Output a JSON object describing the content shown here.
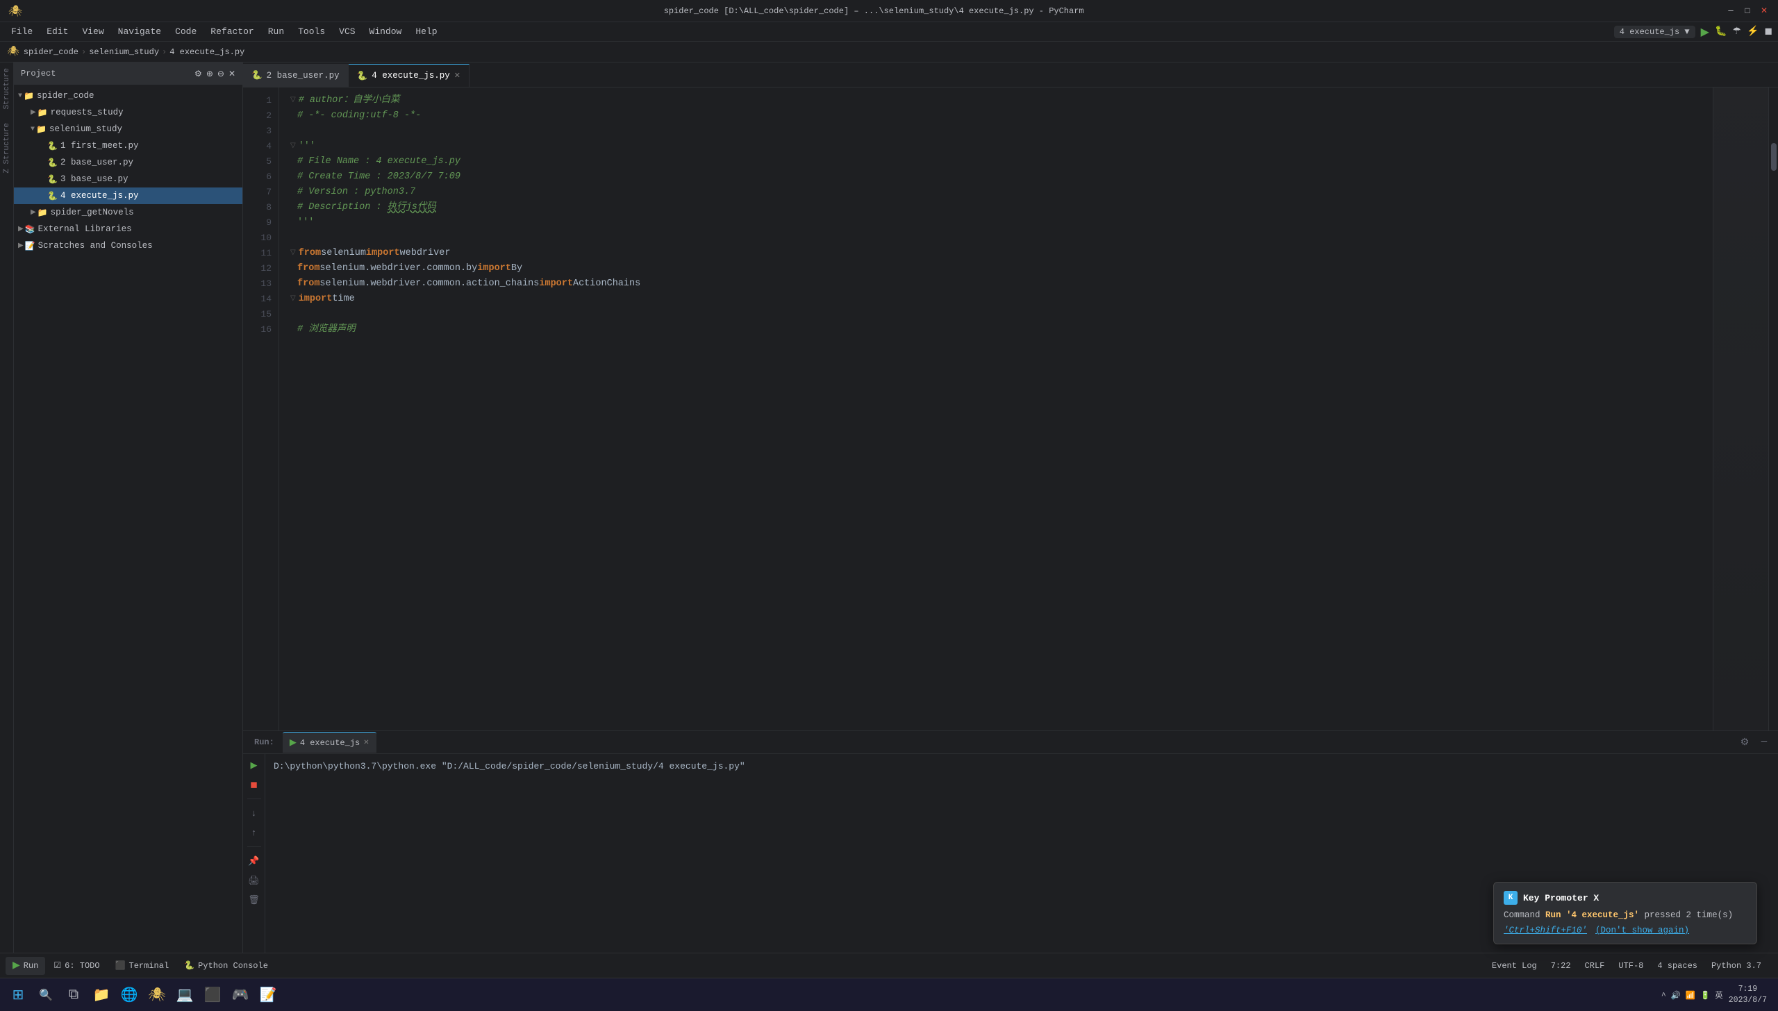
{
  "window": {
    "title": "spider_code [D:\\ALL_code\\spider_code] – ...\\selenium_study\\4 execute_js.py - PyCharm"
  },
  "menu": {
    "items": [
      "File",
      "Edit",
      "View",
      "Navigate",
      "Code",
      "Refactor",
      "Run",
      "Tools",
      "VCS",
      "Window",
      "Help"
    ]
  },
  "nav": {
    "project": "spider_code",
    "path1": "D:\\ALL_code\\spider_code",
    "file": "4 execute_js.py"
  },
  "toolbar": {
    "active_file": "4 execute_js"
  },
  "sidebar": {
    "title": "Project",
    "items": [
      {
        "label": "spider_code",
        "type": "folder",
        "indent": 0,
        "expanded": true
      },
      {
        "label": "requests_study",
        "type": "folder",
        "indent": 1,
        "expanded": false
      },
      {
        "label": "selenium_study",
        "type": "folder",
        "indent": 1,
        "expanded": true
      },
      {
        "label": "1 first_meet.py",
        "type": "py",
        "indent": 2
      },
      {
        "label": "2 base_user.py",
        "type": "py",
        "indent": 2
      },
      {
        "label": "3 base_use.py",
        "type": "py",
        "indent": 2
      },
      {
        "label": "4 execute_js.py",
        "type": "py",
        "indent": 2,
        "selected": true
      },
      {
        "label": "spider_getNovels",
        "type": "folder",
        "indent": 1,
        "expanded": false
      },
      {
        "label": "External Libraries",
        "type": "folder",
        "indent": 0,
        "expanded": false
      },
      {
        "label": "Scratches and Consoles",
        "type": "folder",
        "indent": 0,
        "expanded": false
      }
    ]
  },
  "tabs": {
    "items": [
      {
        "label": "2 base_user.py",
        "active": false,
        "icon": "py"
      },
      {
        "label": "4 execute_js.py",
        "active": true,
        "icon": "py"
      }
    ]
  },
  "code": {
    "lines": [
      {
        "num": 1,
        "content_html": "<span class='fold-arrow'>▽</span><span class='c-comment'># author：自学小白菜</span>"
      },
      {
        "num": 2,
        "content_html": "<span class='fold-arrow'> </span><span class='c-comment'># -*- coding:utf-8 -*-</span>"
      },
      {
        "num": 3,
        "content_html": ""
      },
      {
        "num": 4,
        "content_html": "<span class='fold-arrow'>▽</span><span class='c-docstring'>'''</span>"
      },
      {
        "num": 5,
        "content_html": "<span class='fold-arrow'> </span><span class='c-comment'># File Name : 4 execute_js.py</span>"
      },
      {
        "num": 6,
        "content_html": "<span class='fold-arrow'> </span><span class='c-comment'># Create Time : 2023/8/7 7:09</span>"
      },
      {
        "num": 7,
        "content_html": "<span class='fold-arrow'> </span><span class='c-comment'># Version : python3.7</span>"
      },
      {
        "num": 8,
        "content_html": "<span class='fold-arrow'> </span><span class='c-comment'># Description :  <span class='c-squiggly'>执行js代码</span></span>"
      },
      {
        "num": 9,
        "content_html": "<span class='fold-arrow'> </span><span class='c-docstring'>'''</span>"
      },
      {
        "num": 10,
        "content_html": ""
      },
      {
        "num": 11,
        "content_html": "<span class='fold-arrow'>▽</span><span class='c-keyword'>from</span> <span class='c-module'>selenium</span> <span class='c-keyword'>import</span> <span class='c-plain'>webdriver</span>"
      },
      {
        "num": 12,
        "content_html": "<span class='fold-arrow'> </span><span class='c-keyword'>from</span> <span class='c-plain'>selenium.webdriver.common.by</span> <span class='c-keyword'>import</span> <span class='c-plain'>By</span>"
      },
      {
        "num": 13,
        "content_html": "<span class='fold-arrow'> </span><span class='c-keyword'>from</span> <span class='c-plain'>selenium.webdriver.common.action_chains</span> <span class='c-keyword'>import</span> <span class='c-plain'>ActionChains</span>"
      },
      {
        "num": 14,
        "content_html": "<span class='fold-arrow'>▽</span><span class='c-keyword'>import</span> <span class='c-plain'>time</span>"
      },
      {
        "num": 15,
        "content_html": ""
      },
      {
        "num": 16,
        "content_html": "<span class='fold-arrow'> </span><span class='c-comment'># 浏览器声明</span>"
      }
    ]
  },
  "run_panel": {
    "label": "Run:",
    "tab_label": "4 execute_js",
    "command": "D:\\python\\python3.7\\python.exe \"D:/ALL_code/spider_code/selenium_study/4 execute_js.py\""
  },
  "key_promoter": {
    "title": "Key Promoter X",
    "text1": "Command ",
    "highlight": "Run '4 execute_js'",
    "text2": " pressed 2 time(s)",
    "shortcut": "'Ctrl+Shift+F10'",
    "dont_show": "(Don't show again)"
  },
  "status_bar": {
    "line": "7:22",
    "line_ending": "CRLF",
    "encoding": "UTF-8",
    "indent": "4 spaces",
    "python": "Python 3.7",
    "event_log": "Event Log"
  },
  "bottom_tools": [
    {
      "label": "Run",
      "icon": "▶",
      "active": false
    },
    {
      "label": "6: TODO",
      "icon": "☑",
      "active": false
    },
    {
      "label": "Terminal",
      "icon": "⬛",
      "active": false
    },
    {
      "label": "Python Console",
      "icon": "🐍",
      "active": false
    }
  ],
  "taskbar": {
    "time": "7:19",
    "date": "2023/8/7"
  }
}
